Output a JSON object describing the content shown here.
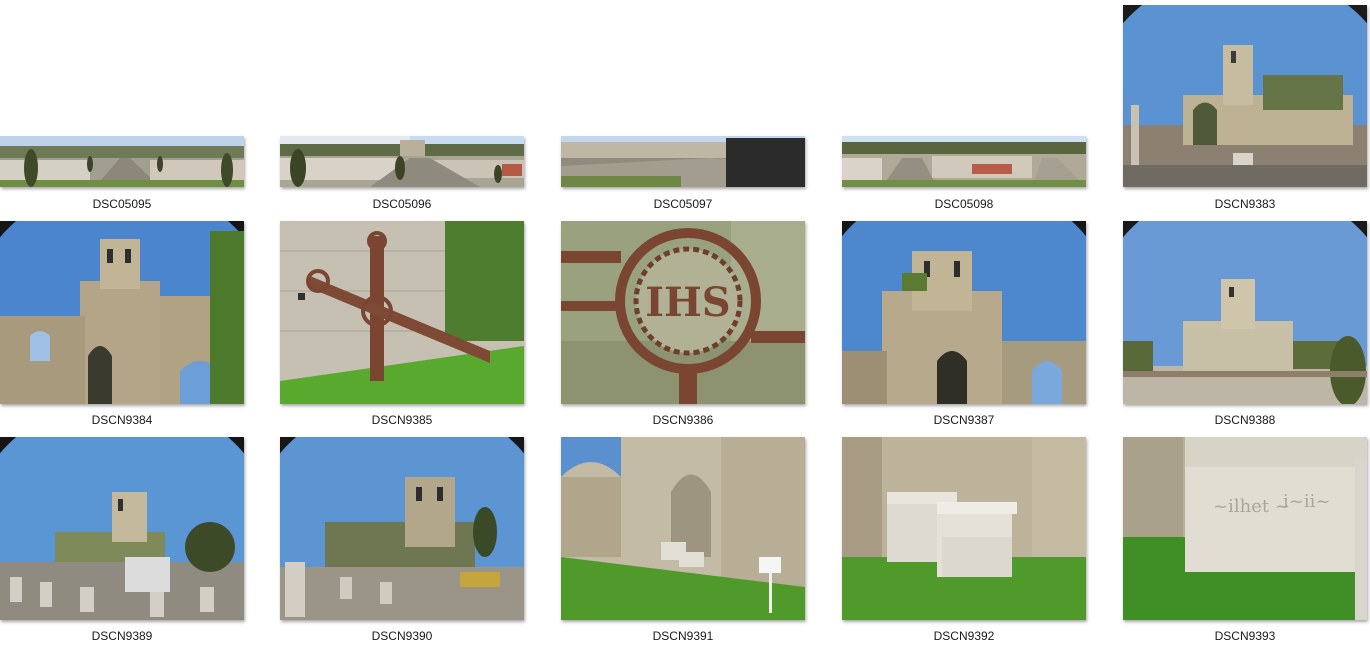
{
  "thumbnails": [
    {
      "label": "DSC05095",
      "scene": "cemetery-panorama"
    },
    {
      "label": "DSC05096",
      "scene": "cemetery-panorama"
    },
    {
      "label": "DSC05097",
      "scene": "wall-panorama"
    },
    {
      "label": "DSC05098",
      "scene": "cemetery-panorama"
    },
    {
      "label": "DSCN9383",
      "scene": "ruined-church"
    },
    {
      "label": "DSCN9384",
      "scene": "church-tower-arches"
    },
    {
      "label": "DSCN9385",
      "scene": "iron-cross-wall"
    },
    {
      "label": "DSCN9386",
      "scene": "iron-cross-closeup"
    },
    {
      "label": "DSCN9387",
      "scene": "church-tower-arch"
    },
    {
      "label": "DSCN9388",
      "scene": "church-distant"
    },
    {
      "label": "DSCN9389",
      "scene": "cemetery-church"
    },
    {
      "label": "DSCN9390",
      "scene": "cemetery-church"
    },
    {
      "label": "DSCN9391",
      "scene": "cloister-arches"
    },
    {
      "label": "DSCN9392",
      "scene": "stone-tombs"
    },
    {
      "label": "DSCN9393",
      "scene": "stone-tomb-closeup"
    }
  ],
  "colors": {
    "sky": "#4f86c9",
    "stone": "#b6ab92",
    "grass": "#4f9a2b",
    "iron": "#7a4632",
    "background": "#ffffff"
  }
}
